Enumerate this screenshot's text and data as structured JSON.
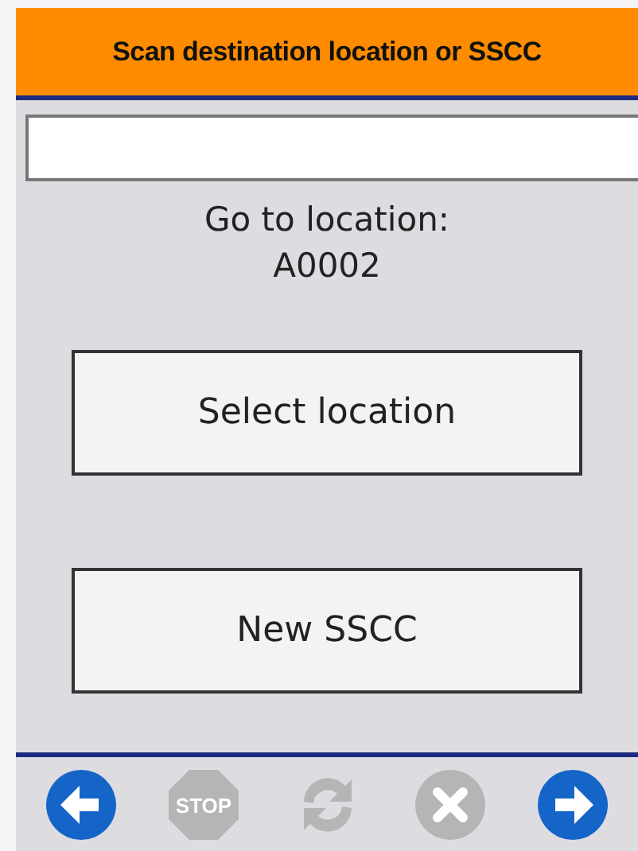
{
  "header": {
    "title": "Scan destination location or SSCC"
  },
  "instruction": {
    "label": "Go to location:",
    "location": "A0002"
  },
  "buttons": [
    {
      "label": "Select location"
    },
    {
      "label": "New SSCC"
    }
  ],
  "toolbar": [
    {
      "kind": "back",
      "disabled": false
    },
    {
      "kind": "stop",
      "disabled": true,
      "label": "STOP"
    },
    {
      "kind": "refresh",
      "disabled": true
    },
    {
      "kind": "cancel",
      "disabled": true
    },
    {
      "kind": "forward",
      "disabled": false
    }
  ]
}
